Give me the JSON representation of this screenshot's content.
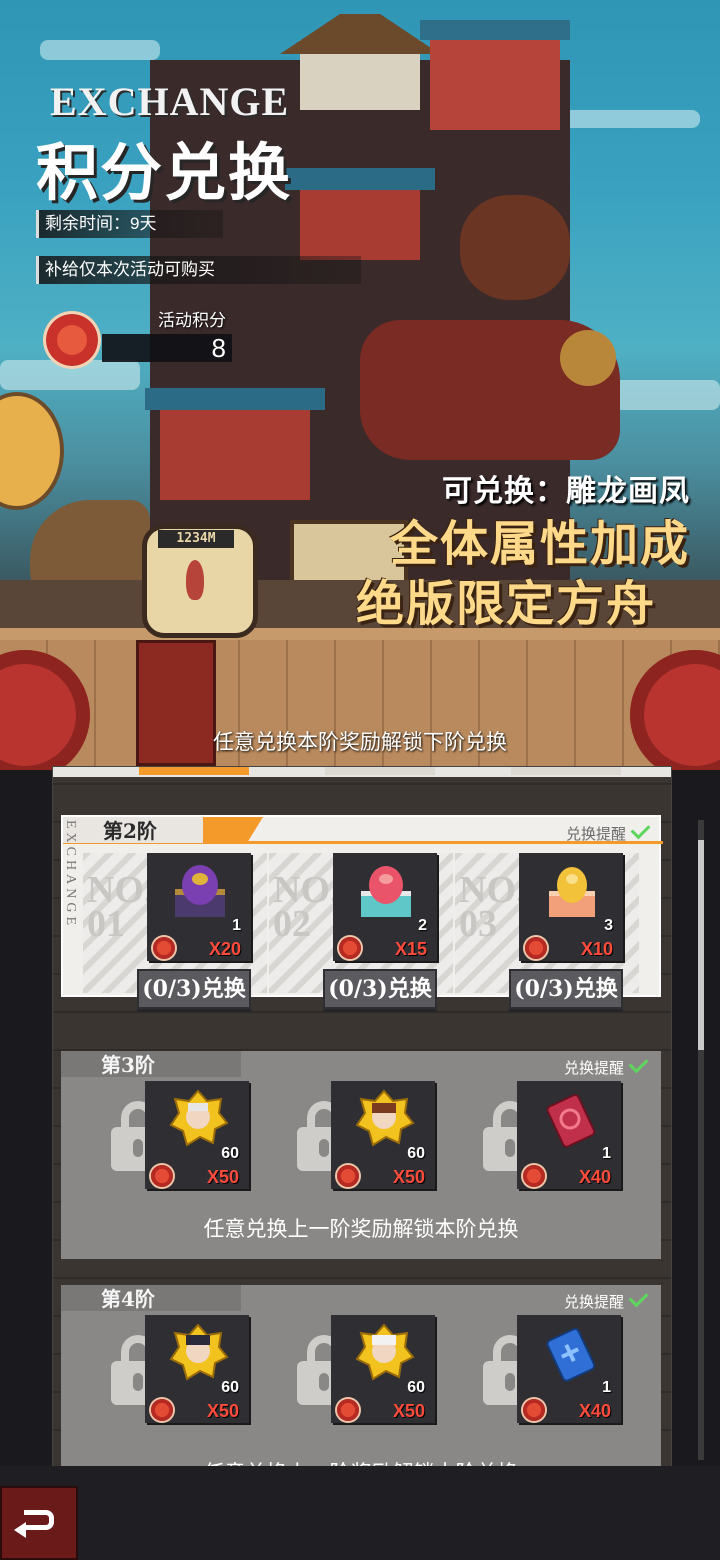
{
  "header": {
    "title_en": "EXCHANGE",
    "title_cn": "积分兑换",
    "remaining_time": "剩余时间：9天",
    "supply_note": "补给仅本次活动可购买",
    "points_label": "活动积分",
    "points_value": "8"
  },
  "promo": {
    "sub": "可兑换：雕龙画凤",
    "line1": "全体属性加成",
    "line2": "绝版限定方舟",
    "clock": "1234M"
  },
  "unlock_hint_top": "任意兑换本阶奖励解锁下阶兑换",
  "side_text": "EXCHANGE",
  "tiers": [
    {
      "label": "第2阶",
      "remind": "兑换提醒",
      "slots": [
        {
          "no_line1": "NO.",
          "no_line2": "01",
          "count": "1",
          "cost": "X20",
          "item": "purple-egg-box-icon",
          "button": "(0/3)兑换"
        },
        {
          "no_line1": "NO.",
          "no_line2": "02",
          "count": "2",
          "cost": "X15",
          "item": "pink-egg-box-icon",
          "button": "(0/3)兑换"
        },
        {
          "no_line1": "NO.",
          "no_line2": "03",
          "count": "3",
          "cost": "X10",
          "item": "gold-egg-box-icon",
          "button": "(0/3)兑换"
        }
      ]
    },
    {
      "label": "第3阶",
      "remind": "兑换提醒",
      "hint": "任意兑换上一阶奖励解锁本阶兑换",
      "slots": [
        {
          "count": "60",
          "cost": "X50",
          "item": "character-shard-icon"
        },
        {
          "count": "60",
          "cost": "X50",
          "item": "character-shard-icon"
        },
        {
          "count": "1",
          "cost": "X40",
          "item": "red-ticket-icon"
        }
      ]
    },
    {
      "label": "第4阶",
      "remind": "兑换提醒",
      "hint": "任意兑换上一阶奖励解锁本阶兑换",
      "slots": [
        {
          "count": "60",
          "cost": "X50",
          "item": "character-shard-icon"
        },
        {
          "count": "60",
          "cost": "X50",
          "item": "character-shard-icon"
        },
        {
          "count": "1",
          "cost": "X40",
          "item": "blue-ticket-icon"
        }
      ]
    }
  ],
  "colors": {
    "accent": "#f39a2b",
    "cost_red": "#ff4b3b",
    "check_green": "#5ed65e"
  }
}
